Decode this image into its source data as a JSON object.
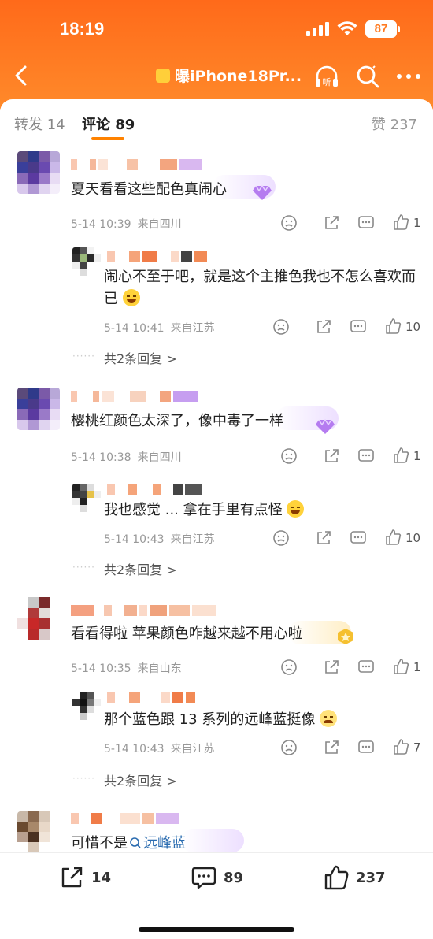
{
  "status_bar": {
    "time": "18:19",
    "battery": "87"
  },
  "header": {
    "title": "曝iPhone18Pr...",
    "listen_label": "听"
  },
  "tabs": {
    "repost": "转发 14",
    "comments": "评论 89",
    "likes": "赞 237"
  },
  "comments": [
    {
      "text": "夏天看看这些配色真闹心",
      "time": "5-14 10:39",
      "location": "来自四川",
      "likes": "1",
      "reply": {
        "text": "闹心不至于吧，就是这个主推色我也不怎么喜欢而已",
        "time": "5-14 10:41",
        "location": "来自江苏",
        "likes": "10"
      },
      "more": "共2条回复 >"
    },
    {
      "text": "樱桃红颜色太深了，像中毒了一样",
      "time": "5-14 10:38",
      "location": "来自四川",
      "likes": "1",
      "reply": {
        "text": "我也感觉 ... 拿在手里有点怪",
        "time": "5-14 10:43",
        "location": "来自江苏",
        "likes": "10"
      },
      "more": "共2条回复 >"
    },
    {
      "text": "看看得啦 苹果颜色咋越来越不用心啦",
      "time": "5-14 10:35",
      "location": "来自山东",
      "likes": "1",
      "reply": {
        "text": "那个蓝色跟 13 系列的远峰蓝挺像",
        "time": "5-14 10:43",
        "location": "来自江苏",
        "likes": "7"
      },
      "more": "共2条回复 >"
    },
    {
      "text_prefix": "可惜不是",
      "topic": "远峰蓝"
    }
  ],
  "bottom_bar": {
    "repost_count": "14",
    "comment_count": "89",
    "like_count": "237"
  },
  "colors": {
    "header": "#ff7a20",
    "accent": "#ff8200",
    "link": "#2b6cb0"
  }
}
